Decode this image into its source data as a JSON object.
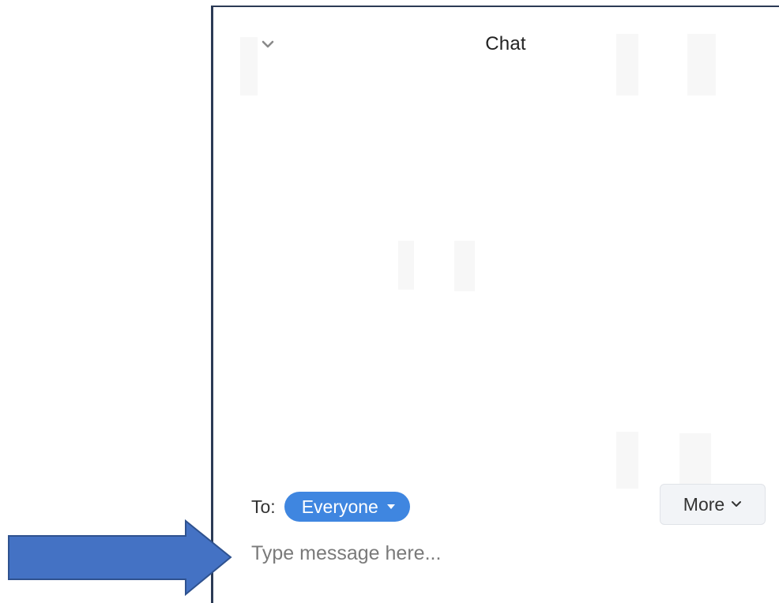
{
  "chat": {
    "title": "Chat",
    "to_label": "To:",
    "recipient": "Everyone",
    "more_label": "More",
    "input_placeholder": "Type message here...",
    "input_value": ""
  },
  "icons": {
    "collapse": "chevron-down-icon",
    "recipient_dropdown": "caret-down-icon",
    "more_dropdown": "chevron-down-icon",
    "annotation": "arrow-right-icon"
  },
  "colors": {
    "recipient_pill": "#3f86e0",
    "arrow_fill": "#4472c4",
    "arrow_stroke": "#2f528f",
    "panel_border": "#2b3a55"
  }
}
